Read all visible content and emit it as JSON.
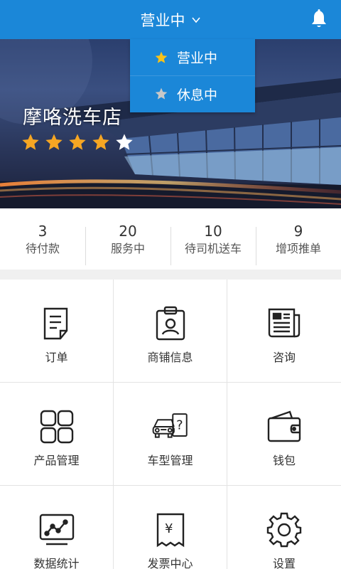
{
  "header": {
    "status": "营业中",
    "status_icon": "chevron-down-icon",
    "bell_icon": "bell-icon",
    "bar_color": "#1b87d8"
  },
  "dropdown": {
    "items": [
      {
        "label": "营业中",
        "icon": "star-icon",
        "icon_color": "#f6c21a"
      },
      {
        "label": "休息中",
        "icon": "star-icon",
        "icon_color": "#c8c8c8"
      }
    ]
  },
  "shop": {
    "name": "摩咯洗车店",
    "rating": 4,
    "rating_max": 5,
    "star_color": "#f6a623"
  },
  "stats": [
    {
      "value": "3",
      "label": "待付款"
    },
    {
      "value": "20",
      "label": "服务中"
    },
    {
      "value": "10",
      "label": "待司机送车"
    },
    {
      "value": "9",
      "label": "增项推单"
    }
  ],
  "menu": [
    {
      "label": "订单",
      "icon": "order-icon"
    },
    {
      "label": "商铺信息",
      "icon": "shop-info-icon"
    },
    {
      "label": "咨询",
      "icon": "news-icon"
    },
    {
      "label": "产品管理",
      "icon": "product-grid-icon"
    },
    {
      "label": "车型管理",
      "icon": "car-model-icon"
    },
    {
      "label": "钱包",
      "icon": "wallet-icon"
    },
    {
      "label": "数据统计",
      "icon": "chart-icon"
    },
    {
      "label": "发票中心",
      "icon": "invoice-icon"
    },
    {
      "label": "设置",
      "icon": "gear-icon"
    }
  ]
}
